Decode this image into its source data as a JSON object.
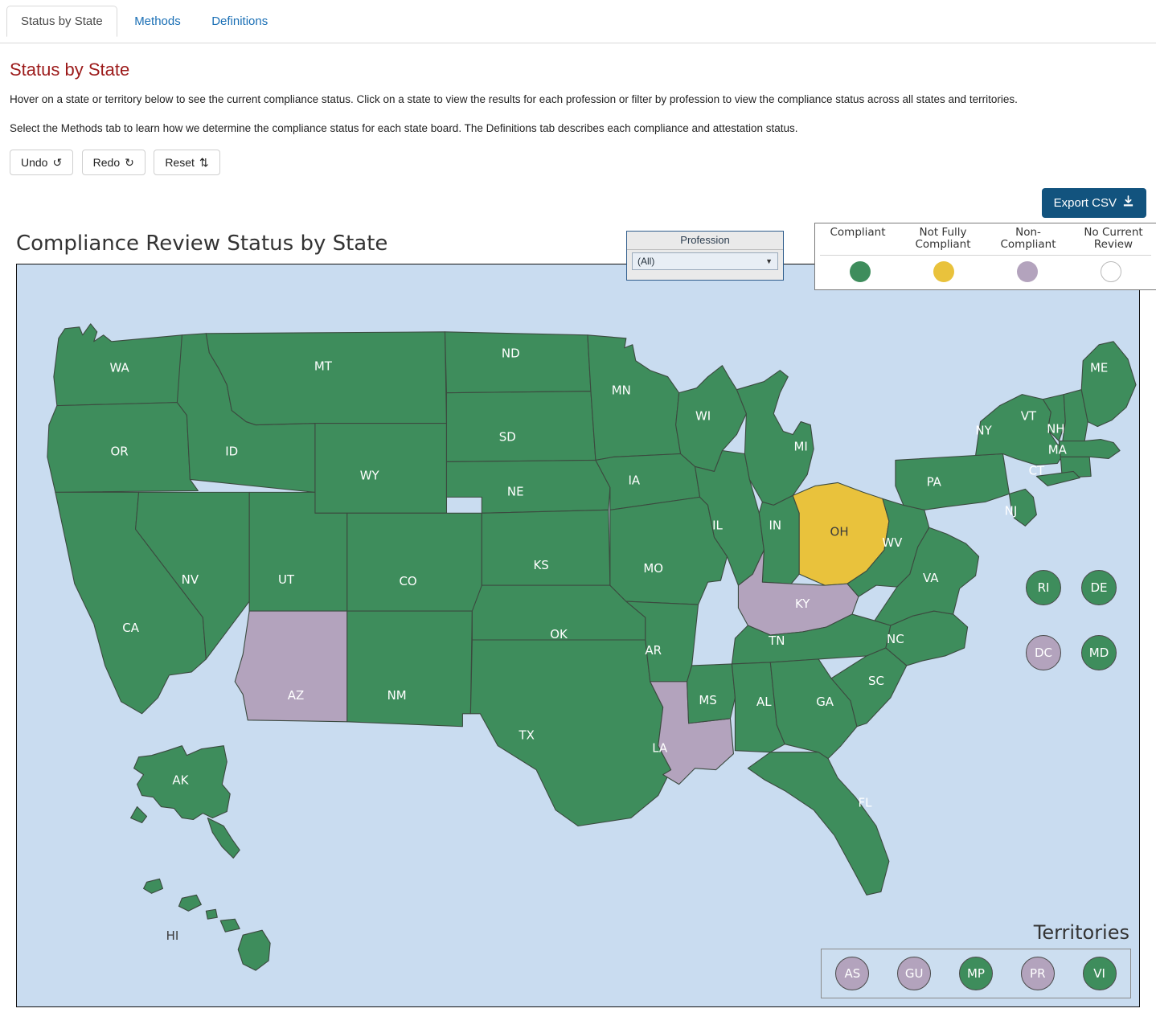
{
  "tabs": [
    {
      "label": "Status by State",
      "active": true
    },
    {
      "label": "Methods",
      "active": false
    },
    {
      "label": "Definitions",
      "active": false
    }
  ],
  "page": {
    "title": "Status by State",
    "paragraph1": "Hover on a state or territory below to see the current compliance status. Click on a state to view the results for each profession or filter by profession to view the compliance status across all states and territories.",
    "paragraph2": "Select the Methods tab to learn how we determine the compliance status for each state board. The Definitions tab describes each compliance and attestation status."
  },
  "toolbar": {
    "undo_label": "Undo",
    "undo_icon": "undo-arrow-icon",
    "redo_label": "Redo",
    "redo_icon": "redo-arrow-icon",
    "reset_label": "Reset",
    "reset_icon": "refresh-icon",
    "export_label": "Export CSV",
    "export_icon": "download-icon"
  },
  "viz": {
    "title": "Compliance Review Status by State",
    "filter": {
      "header": "Profession",
      "value": "(All)",
      "caret_icon": "chevron-down-icon"
    },
    "legend": {
      "items": [
        {
          "label": "Compliant",
          "color": "#3e8d5c",
          "filled": true
        },
        {
          "label": "Not Fully Compliant",
          "color": "#e9c23c",
          "filled": true
        },
        {
          "label": "Non-Compliant",
          "color": "#b3a3bd",
          "filled": true
        },
        {
          "label": "No Current Review",
          "color": "#ffffff",
          "filled": false
        }
      ]
    },
    "territories_label": "Territories"
  },
  "colors": {
    "compliant": "#3e8d5c",
    "not_fully_compliant": "#e9c23c",
    "non_compliant": "#b3a3bd",
    "no_current_review": "#ffffff",
    "water": "#c9dcf0",
    "accent": "#12537e",
    "heading": "#9c1a1a"
  },
  "chart_data": {
    "type": "map",
    "title": "Compliance Review Status by State",
    "legend_position": "top-right",
    "categories": [
      "Compliant",
      "Not Fully Compliant",
      "Non-Compliant",
      "No Current Review"
    ],
    "states": [
      {
        "code": "WA",
        "status": "Compliant"
      },
      {
        "code": "OR",
        "status": "Compliant"
      },
      {
        "code": "CA",
        "status": "Compliant"
      },
      {
        "code": "NV",
        "status": "Compliant"
      },
      {
        "code": "ID",
        "status": "Compliant"
      },
      {
        "code": "MT",
        "status": "Compliant"
      },
      {
        "code": "WY",
        "status": "Compliant"
      },
      {
        "code": "UT",
        "status": "Compliant"
      },
      {
        "code": "AZ",
        "status": "Non-Compliant"
      },
      {
        "code": "CO",
        "status": "Compliant"
      },
      {
        "code": "NM",
        "status": "Compliant"
      },
      {
        "code": "ND",
        "status": "Compliant"
      },
      {
        "code": "SD",
        "status": "Compliant"
      },
      {
        "code": "NE",
        "status": "Compliant"
      },
      {
        "code": "KS",
        "status": "Compliant"
      },
      {
        "code": "OK",
        "status": "Compliant"
      },
      {
        "code": "TX",
        "status": "Compliant"
      },
      {
        "code": "MN",
        "status": "Compliant"
      },
      {
        "code": "IA",
        "status": "Compliant"
      },
      {
        "code": "MO",
        "status": "Compliant"
      },
      {
        "code": "AR",
        "status": "Compliant"
      },
      {
        "code": "LA",
        "status": "Non-Compliant"
      },
      {
        "code": "WI",
        "status": "Compliant"
      },
      {
        "code": "IL",
        "status": "Compliant"
      },
      {
        "code": "MS",
        "status": "Compliant"
      },
      {
        "code": "MI",
        "status": "Compliant"
      },
      {
        "code": "IN",
        "status": "Compliant"
      },
      {
        "code": "OH",
        "status": "Not Fully Compliant"
      },
      {
        "code": "KY",
        "status": "Non-Compliant"
      },
      {
        "code": "TN",
        "status": "Compliant"
      },
      {
        "code": "AL",
        "status": "Compliant"
      },
      {
        "code": "GA",
        "status": "Compliant"
      },
      {
        "code": "FL",
        "status": "Compliant"
      },
      {
        "code": "SC",
        "status": "Compliant"
      },
      {
        "code": "NC",
        "status": "Compliant"
      },
      {
        "code": "VA",
        "status": "Compliant"
      },
      {
        "code": "WV",
        "status": "Compliant"
      },
      {
        "code": "PA",
        "status": "Compliant"
      },
      {
        "code": "NY",
        "status": "Compliant"
      },
      {
        "code": "VT",
        "status": "Compliant"
      },
      {
        "code": "NH",
        "status": "Compliant"
      },
      {
        "code": "ME",
        "status": "Compliant"
      },
      {
        "code": "MA",
        "status": "Compliant"
      },
      {
        "code": "CT",
        "status": "Compliant"
      },
      {
        "code": "NJ",
        "status": "Compliant"
      },
      {
        "code": "RI",
        "status": "Compliant"
      },
      {
        "code": "DE",
        "status": "Compliant"
      },
      {
        "code": "MD",
        "status": "Compliant"
      },
      {
        "code": "DC",
        "status": "Non-Compliant"
      },
      {
        "code": "AK",
        "status": "Compliant"
      },
      {
        "code": "HI",
        "status": "Compliant"
      }
    ],
    "territories": [
      {
        "code": "AS",
        "status": "Non-Compliant"
      },
      {
        "code": "GU",
        "status": "Non-Compliant"
      },
      {
        "code": "MP",
        "status": "Compliant"
      },
      {
        "code": "PR",
        "status": "Non-Compliant"
      },
      {
        "code": "VI",
        "status": "Compliant"
      }
    ]
  }
}
